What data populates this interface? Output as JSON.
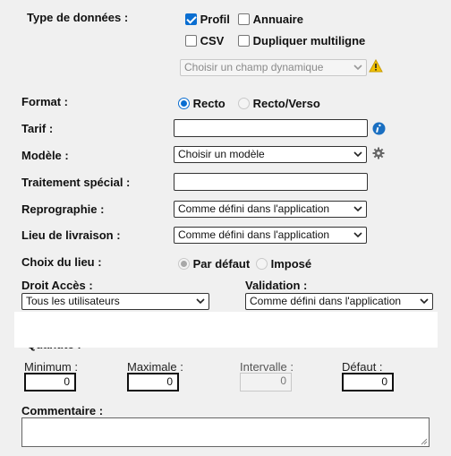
{
  "type_donnees": {
    "label": "Type de données :",
    "options": {
      "profil": {
        "label": "Profil",
        "checked": true
      },
      "annuaire": {
        "label": "Annuaire",
        "checked": false
      },
      "csv": {
        "label": "CSV",
        "checked": false
      },
      "dupliquer": {
        "label": "Dupliquer multiligne",
        "checked": false
      }
    },
    "champ_dynamique_placeholder": "Choisir un champ dynamique"
  },
  "format": {
    "label": "Format :",
    "recto": "Recto",
    "recto_verso": "Recto/Verso",
    "selected": "Recto"
  },
  "tarif": {
    "label": "Tarif :",
    "value": ""
  },
  "modele": {
    "label": "Modèle :",
    "value": "Choisir un modèle"
  },
  "traitement": {
    "label": "Traitement spécial :",
    "value": ""
  },
  "reprographie": {
    "label": "Reprographie :",
    "value": "Comme défini dans l'application"
  },
  "lieu_livraison": {
    "label": "Lieu de livraison :",
    "value": "Comme défini dans l'application"
  },
  "choix_lieu": {
    "label": "Choix du lieu :",
    "par_defaut": "Par défaut",
    "impose": "Imposé",
    "selected": "Par défaut"
  },
  "droit_acces": {
    "label": "Droit Accès :",
    "value": "Tous les utilisateurs"
  },
  "validation": {
    "label": "Validation :",
    "value": "Comme défini dans l'application"
  },
  "quantite": {
    "label": "Quantité :",
    "minimum": {
      "label": "Minimum :",
      "value": "0"
    },
    "maximale": {
      "label": "Maximale :",
      "value": "0"
    },
    "intervalle": {
      "label": "Intervalle :",
      "value": "0"
    },
    "defaut": {
      "label": "Défaut :",
      "value": "0"
    }
  },
  "commentaire": {
    "label": "Commentaire :",
    "value": ""
  },
  "colors": {
    "accent": "#0a6ed1",
    "warning": "#f2c200",
    "info": "#1a6fc1"
  }
}
